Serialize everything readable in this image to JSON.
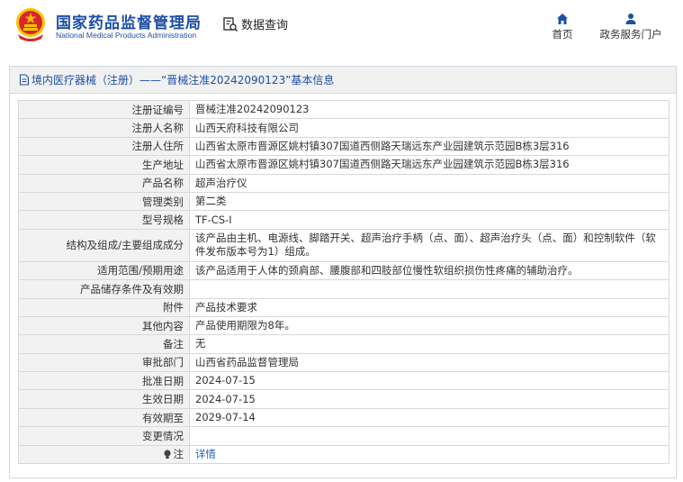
{
  "header": {
    "brand_cn": "国家药品监督管理局",
    "brand_en": "National Medical Products Administration",
    "query_label": "数据查询",
    "nav": [
      {
        "label": "首页",
        "icon": "home-icon"
      },
      {
        "label": "政务服务门户",
        "icon": "user-icon"
      }
    ]
  },
  "panel": {
    "title": "境内医疗器械（注册）——“晋械注准20242090123”基本信息"
  },
  "rows": [
    {
      "label": "注册证编号",
      "value": "晋械注准20242090123"
    },
    {
      "label": "注册人名称",
      "value": "山西天府科技有限公司"
    },
    {
      "label": "注册人住所",
      "value": "山西省太原市晋源区姚村镇307国道西侧路天瑞远东产业园建筑示范园B栋3层316"
    },
    {
      "label": "生产地址",
      "value": "山西省太原市晋源区姚村镇307国道西侧路天瑞远东产业园建筑示范园B栋3层316"
    },
    {
      "label": "产品名称",
      "value": "超声治疗仪"
    },
    {
      "label": "管理类别",
      "value": "第二类"
    },
    {
      "label": "型号规格",
      "value": "TF-CS-I"
    },
    {
      "label": "结构及组成/主要组成成分",
      "value": "该产品由主机、电源线、脚踏开关、超声治疗手柄（点、面）、超声治疗头（点、面）和控制软件（软件发布版本号为1）组成。"
    },
    {
      "label": "适用范围/预期用途",
      "value": "该产品适用于人体的颈肩部、腰腹部和四肢部位慢性软组织损伤性疼痛的辅助治疗。"
    },
    {
      "label": "产品储存条件及有效期",
      "value": ""
    },
    {
      "label": "附件",
      "value": "产品技术要求"
    },
    {
      "label": "其他内容",
      "value": "产品使用期限为8年。"
    },
    {
      "label": "备注",
      "value": "无"
    },
    {
      "label": "审批部门",
      "value": "山西省药品监督管理局"
    },
    {
      "label": "批准日期",
      "value": "2024-07-15"
    },
    {
      "label": "生效日期",
      "value": "2024-07-15"
    },
    {
      "label": "有效期至",
      "value": "2029-07-14"
    },
    {
      "label": "变更情况",
      "value": ""
    }
  ],
  "note": {
    "label": "注",
    "link": "详情"
  },
  "colors": {
    "brand_blue": "#1d4fa5",
    "emblem_red": "#d8262c",
    "emblem_gold": "#f5c400",
    "link_blue": "#1d5fc7"
  }
}
